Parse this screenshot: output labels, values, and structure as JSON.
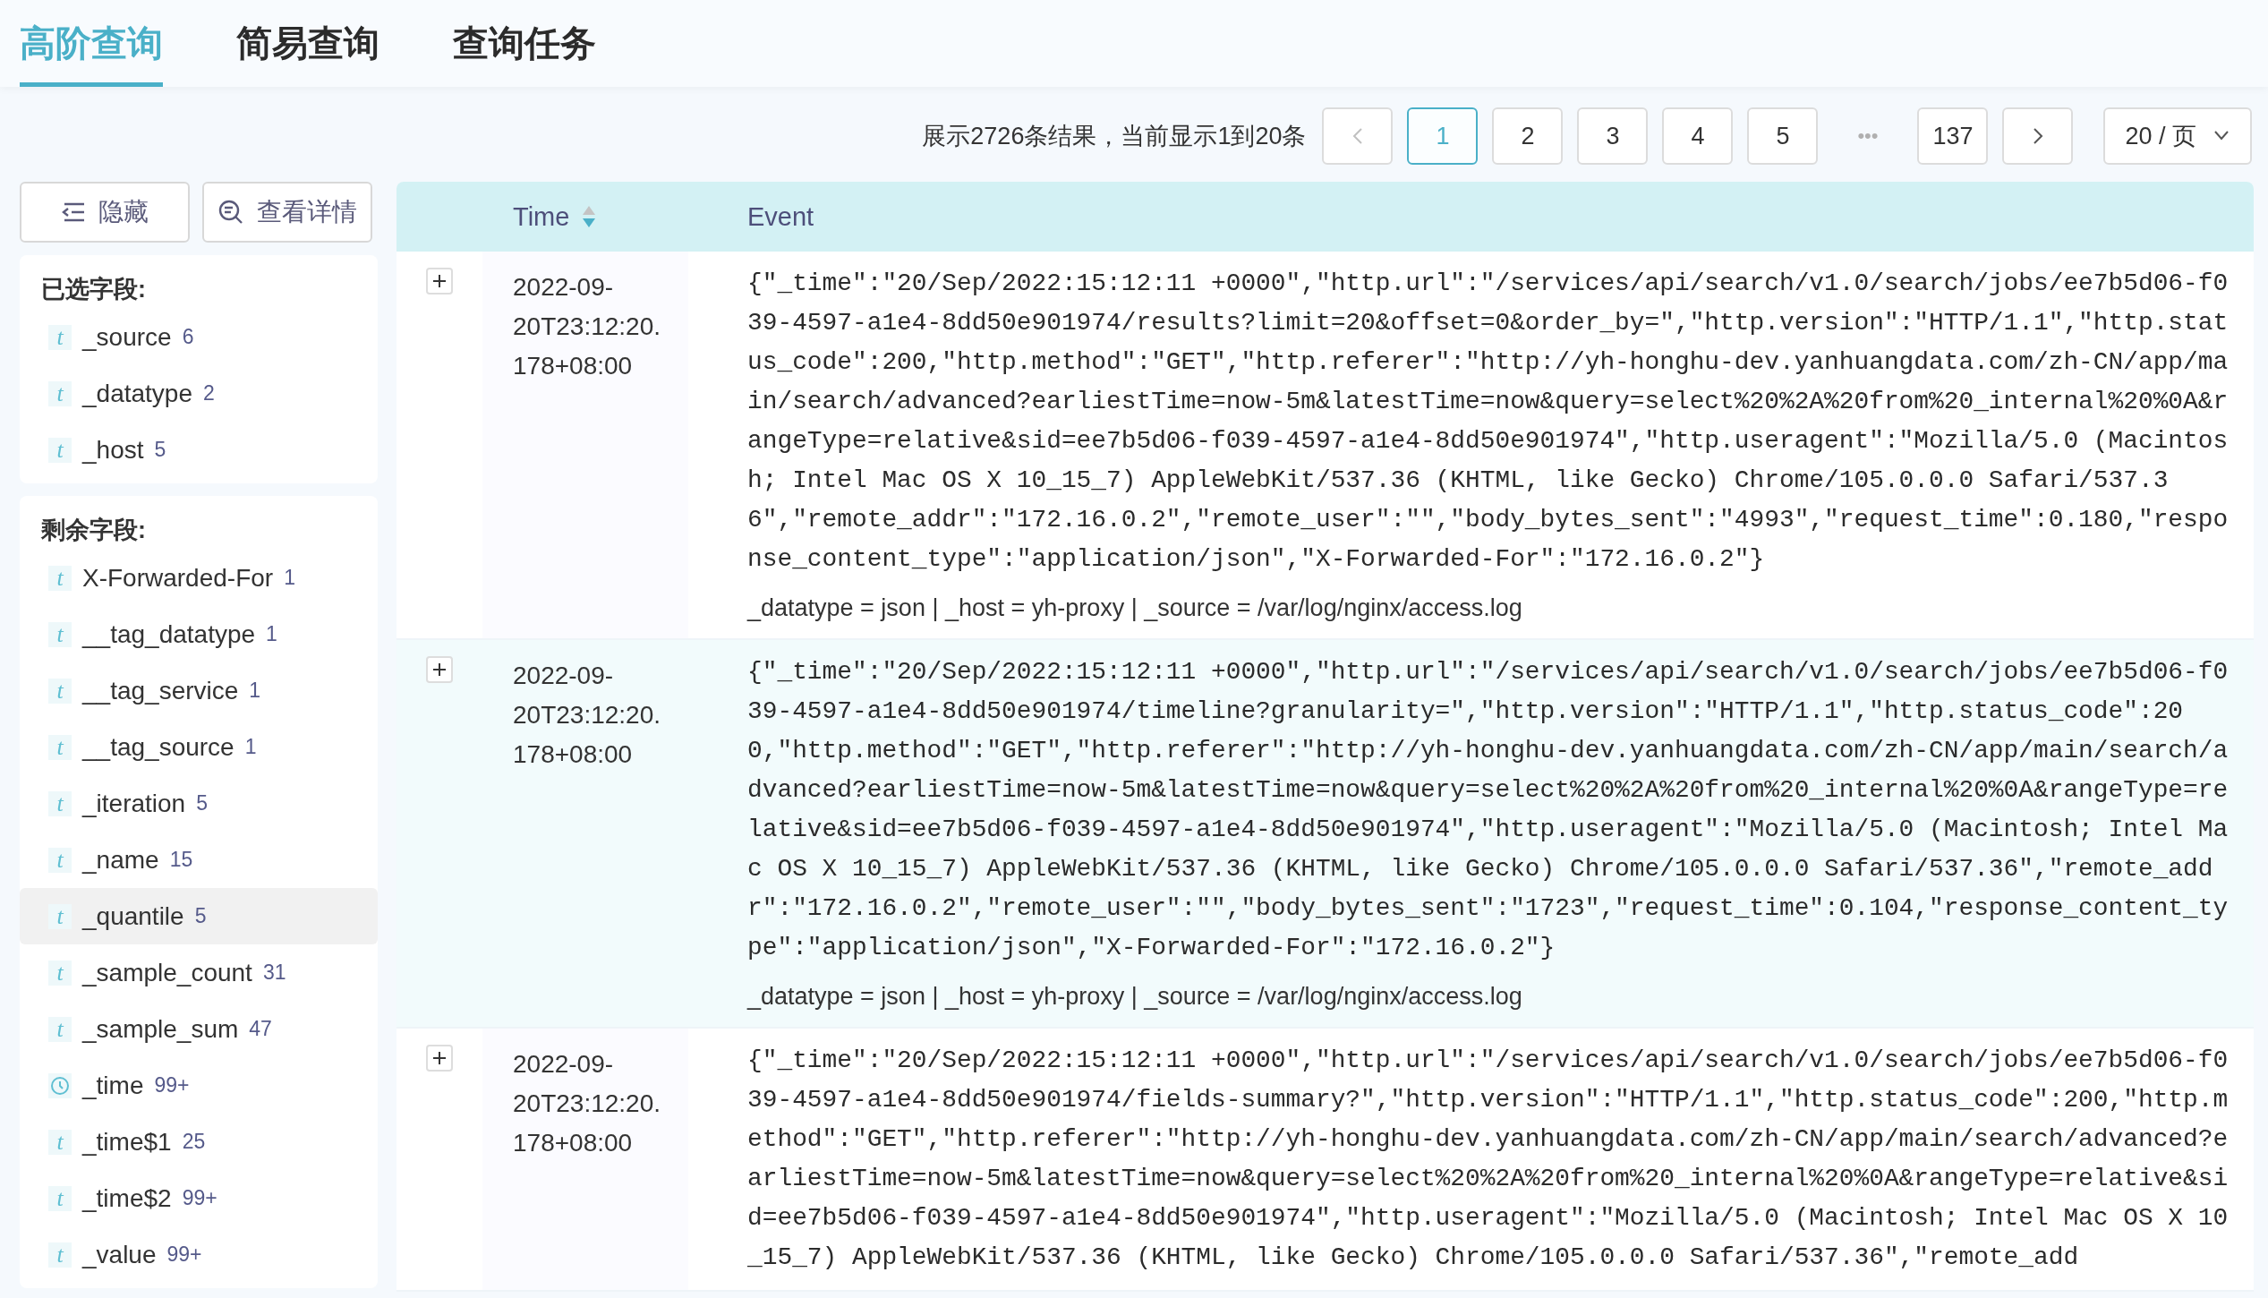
{
  "tabs": [
    {
      "label": "高阶查询",
      "selected": true
    },
    {
      "label": "简易查询",
      "selected": false
    },
    {
      "label": "查询任务",
      "selected": false
    }
  ],
  "pagination": {
    "summary": "展示2726条结果，当前显示1到20条",
    "prev_disabled": true,
    "next_disabled": false,
    "pages": [
      {
        "label": "1",
        "selected": true
      },
      {
        "label": "2",
        "selected": false
      },
      {
        "label": "3",
        "selected": false
      },
      {
        "label": "4",
        "selected": false
      },
      {
        "label": "5",
        "selected": false
      },
      {
        "label": "•••",
        "kind": "ellipsis"
      },
      {
        "label": "137",
        "selected": false
      }
    ],
    "page_size": "20 / 页"
  },
  "sidebar": {
    "buttons": [
      {
        "label": "隐藏"
      },
      {
        "label": "查看详情"
      }
    ],
    "sections": [
      {
        "title": "已选字段:",
        "fields": [
          {
            "name": "_source",
            "count": "6",
            "kind": "text",
            "icon_text": "t",
            "hovered": false
          },
          {
            "name": "_datatype",
            "count": "2",
            "kind": "text",
            "icon_text": "t",
            "hovered": false
          },
          {
            "name": "_host",
            "count": "5",
            "kind": "text",
            "icon_text": "t",
            "hovered": false
          }
        ]
      },
      {
        "title": "剩余字段:",
        "fields": [
          {
            "name": "X-Forwarded-For",
            "count": "1",
            "kind": "text",
            "icon_text": "t",
            "hovered": false
          },
          {
            "name": "__tag_datatype",
            "count": "1",
            "kind": "text",
            "icon_text": "t",
            "hovered": false
          },
          {
            "name": "__tag_service",
            "count": "1",
            "kind": "text",
            "icon_text": "t",
            "hovered": false
          },
          {
            "name": "__tag_source",
            "count": "1",
            "kind": "text",
            "icon_text": "t",
            "hovered": false
          },
          {
            "name": "_iteration",
            "count": "5",
            "kind": "text",
            "icon_text": "t",
            "hovered": false
          },
          {
            "name": "_name",
            "count": "15",
            "kind": "text",
            "icon_text": "t",
            "hovered": false
          },
          {
            "name": "_quantile",
            "count": "5",
            "kind": "text",
            "icon_text": "t",
            "hovered": true
          },
          {
            "name": "_sample_count",
            "count": "31",
            "kind": "text",
            "icon_text": "t",
            "hovered": false
          },
          {
            "name": "_sample_sum",
            "count": "47",
            "kind": "text",
            "icon_text": "t",
            "hovered": false
          },
          {
            "name": "_time",
            "count": "99+",
            "kind": "time",
            "hovered": false
          },
          {
            "name": "_time$1",
            "count": "25",
            "kind": "text",
            "icon_text": "t",
            "hovered": false
          },
          {
            "name": "_time$2",
            "count": "99+",
            "kind": "text",
            "icon_text": "t",
            "hovered": false
          },
          {
            "name": "_value",
            "count": "99+",
            "kind": "text",
            "icon_text": "t",
            "hovered": false
          }
        ]
      }
    ]
  },
  "table": {
    "columns": [
      {
        "label": "Time",
        "sorted_descending": true
      },
      {
        "label": "Event"
      }
    ],
    "rows": [
      {
        "time": "2022-09-20T23:12:20.178+08:00",
        "hovered": false,
        "event": "{\"_time\":\"20/Sep/2022:15:12:11 +0000\",\"http.url\":\"/services/api/search/v1.0/search/jobs/ee7b5d06-f039-4597-a1e4-8dd50e901974/results?limit=20&offset=0&order_by=\",\"http.version\":\"HTTP/1.1\",\"http.status_code\":200,\"http.method\":\"GET\",\"http.referer\":\"http://yh-honghu-dev.yanhuangdata.com/zh-CN/app/main/search/advanced?earliestTime=now-5m&latestTime=now&query=select%20%2A%20from%20_internal%20%0A&rangeType=relative&sid=ee7b5d06-f039-4597-a1e4-8dd50e901974\",\"http.useragent\":\"Mozilla/5.0 (Macintosh; Intel Mac OS X 10_15_7) AppleWebKit/537.36 (KHTML, like Gecko) Chrome/105.0.0.0 Safari/537.36\",\"remote_addr\":\"172.16.0.2\",\"remote_user\":\"\",\"body_bytes_sent\":\"4993\",\"request_time\":0.180,\"response_content_type\":\"application/json\",\"X-Forwarded-For\":\"172.16.0.2\"}",
        "meta": "_datatype = json | _host = yh-proxy | _source = /var/log/nginx/access.log"
      },
      {
        "time": "2022-09-20T23:12:20.178+08:00",
        "hovered": true,
        "event": "{\"_time\":\"20/Sep/2022:15:12:11 +0000\",\"http.url\":\"/services/api/search/v1.0/search/jobs/ee7b5d06-f039-4597-a1e4-8dd50e901974/timeline?granularity=\",\"http.version\":\"HTTP/1.1\",\"http.status_code\":200,\"http.method\":\"GET\",\"http.referer\":\"http://yh-honghu-dev.yanhuangdata.com/zh-CN/app/main/search/advanced?earliestTime=now-5m&latestTime=now&query=select%20%2A%20from%20_internal%20%0A&rangeType=relative&sid=ee7b5d06-f039-4597-a1e4-8dd50e901974\",\"http.useragent\":\"Mozilla/5.0 (Macintosh; Intel Mac OS X 10_15_7) AppleWebKit/537.36 (KHTML, like Gecko) Chrome/105.0.0.0 Safari/537.36\",\"remote_addr\":\"172.16.0.2\",\"remote_user\":\"\",\"body_bytes_sent\":\"1723\",\"request_time\":0.104,\"response_content_type\":\"application/json\",\"X-Forwarded-For\":\"172.16.0.2\"}",
        "meta": "_datatype = json | _host = yh-proxy | _source = /var/log/nginx/access.log"
      },
      {
        "time": "2022-09-20T23:12:20.178+08:00",
        "hovered": false,
        "event": "{\"_time\":\"20/Sep/2022:15:12:11 +0000\",\"http.url\":\"/services/api/search/v1.0/search/jobs/ee7b5d06-f039-4597-a1e4-8dd50e901974/fields-summary?\",\"http.version\":\"HTTP/1.1\",\"http.status_code\":200,\"http.method\":\"GET\",\"http.referer\":\"http://yh-honghu-dev.yanhuangdata.com/zh-CN/app/main/search/advanced?earliestTime=now-5m&latestTime=now&query=select%20%2A%20from%20_internal%20%0A&rangeType=relative&sid=ee7b5d06-f039-4597-a1e4-8dd50e901974\",\"http.useragent\":\"Mozilla/5.0 (Macintosh; Intel Mac OS X 10_15_7) AppleWebKit/537.36 (KHTML, like Gecko) Chrome/105.0.0.0 Safari/537.36\",\"remote_add"
      }
    ]
  }
}
